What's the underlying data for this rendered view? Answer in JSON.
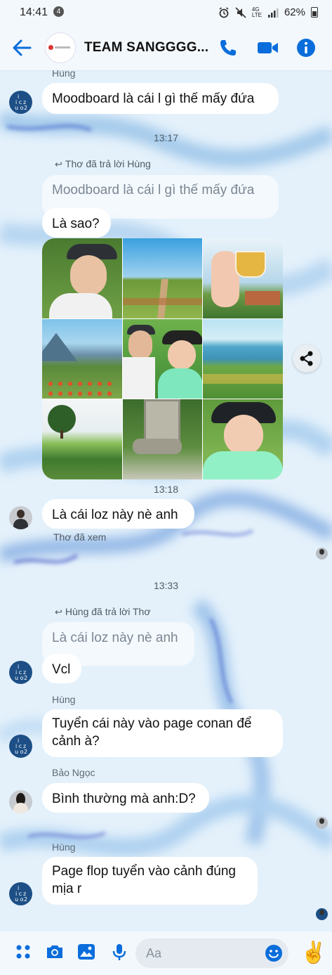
{
  "status_bar": {
    "time": "14:41",
    "notification_count": "4",
    "network": "4G",
    "network_sub": "LTE",
    "battery": "62%"
  },
  "header": {
    "title": "TEAM SANGGGG..."
  },
  "messages": {
    "m1_sender": "Hùng",
    "m1_text": "Moodboard là cái l gì thế mấy đứa",
    "ts1": "13:17",
    "reply1_label": "Thơ đã trả lời Hùng",
    "reply1_quote": "Moodboard là cái l gì thế mấy đứa",
    "m2_text": "Là sao?",
    "ts2": "13:18",
    "m3_text": "Là cái loz này nè anh",
    "seen_text": "Thơ đã xem",
    "ts3": "13:33",
    "reply2_label": "Hùng đã trả lời Thơ",
    "reply2_quote": "Là cái loz này nè anh",
    "m4_text": "Vcl",
    "m5_sender": "Hùng",
    "m5_text": "Tuyển cái này vào page conan để cảnh à?",
    "m6_sender": "Bảo Ngọc",
    "m6_text": "Bình thường mà anh:D?",
    "m7_sender": "Hùng",
    "m7_text": "Page flop tuyển vào cảnh đúng mịa r"
  },
  "composer": {
    "placeholder": "Aa"
  },
  "colors": {
    "accent": "#0a6ddb",
    "bubble": "#ffffff",
    "background": "#e6f2fb"
  },
  "icons": [
    "back-arrow-icon",
    "phone-icon",
    "video-camera-icon",
    "info-icon",
    "reply-arrow-icon",
    "share-icon",
    "apps-grid-icon",
    "camera-icon",
    "image-icon",
    "microphone-icon",
    "emoji-icon",
    "victory-hand-icon"
  ]
}
